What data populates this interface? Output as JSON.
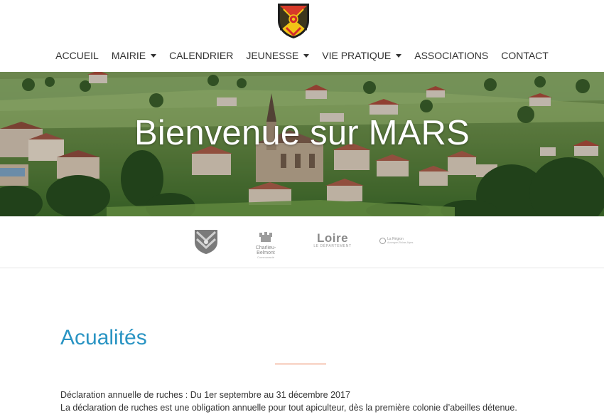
{
  "header": {
    "logo_icon": "coat-of-arms-icon"
  },
  "nav": {
    "items": [
      {
        "label": "ACCUEIL",
        "dropdown": false
      },
      {
        "label": "MAIRIE",
        "dropdown": true
      },
      {
        "label": "CALENDRIER",
        "dropdown": false
      },
      {
        "label": "JEUNESSE",
        "dropdown": true
      },
      {
        "label": "VIE PRATIQUE",
        "dropdown": true
      },
      {
        "label": "ASSOCIATIONS",
        "dropdown": false
      },
      {
        "label": "CONTACT",
        "dropdown": false
      }
    ]
  },
  "hero": {
    "title": "Bienvenue sur MARS"
  },
  "partners": {
    "chateau_name": "Charlieu-Belmont",
    "chateau_sub": "Communauté",
    "loire_name": "Loire",
    "loire_sub": "LE DÉPARTEMENT",
    "region_name": "La Région",
    "region_sub": "Auvergne-Rhône-Alpes"
  },
  "news": {
    "section_title": "Acualités",
    "item_title": "Déclaration annuelle de ruches : Du 1er septembre au 31 décembre 2017",
    "item_body": "La déclaration de ruches est une obligation annuelle pour tout apiculteur, dès la première colonie d’abeilles détenue."
  },
  "colors": {
    "accent_blue": "#2a94c3",
    "accent_orange": "#e8744a",
    "nav_text": "#333333"
  }
}
